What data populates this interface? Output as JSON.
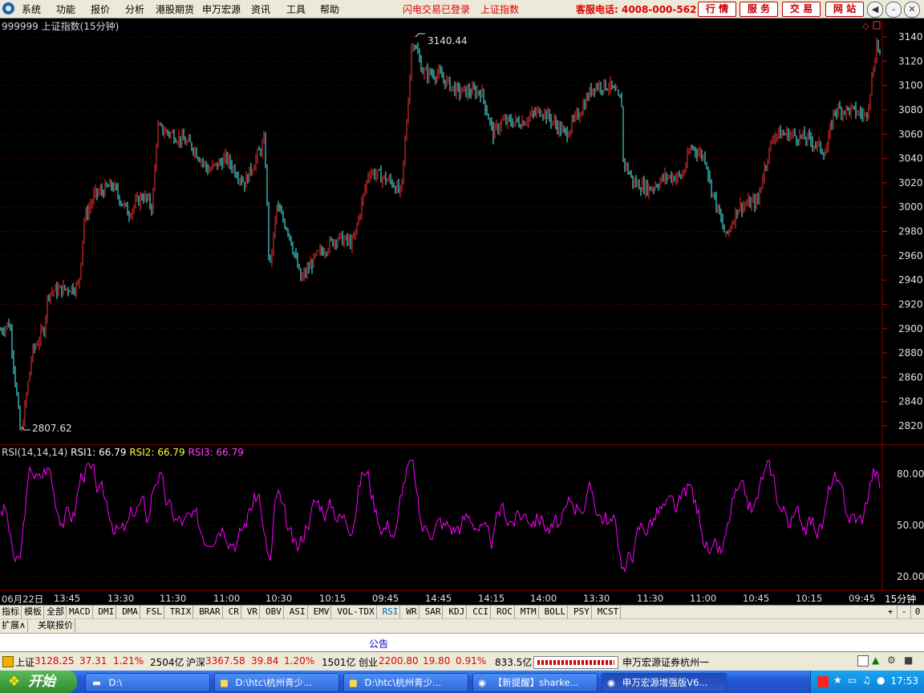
{
  "menu": {
    "items": [
      "系统",
      "功能",
      "报价",
      "分析",
      "港股期货",
      "申万宏源",
      "资讯",
      "工具",
      "帮助"
    ],
    "status_link": "闪电交易已登录",
    "index_link": "上证指数",
    "hotline": "客服电话: 4008-000-562",
    "nav_buttons": [
      "行 情",
      "服 务",
      "交 易",
      "网 站"
    ]
  },
  "chart": {
    "title": "999999 上证指数(15分钟)",
    "high_label": "3140.44",
    "low_label": "2807.62",
    "y_ticks": [
      "3140",
      "3120",
      "3100",
      "3080",
      "3060",
      "3040",
      "3020",
      "3000",
      "2980",
      "2960",
      "2940",
      "2920",
      "2900",
      "2880",
      "2860",
      "2840",
      "2820"
    ],
    "rsi_header": {
      "name": "RSI(14,14,14)",
      "rsi1_label": "RSI1:",
      "rsi1_value": "66.79",
      "rsi2_label": "RSI2:",
      "rsi2_value": "66.79",
      "rsi3_label": "RSI3:",
      "rsi3_value": "66.79"
    },
    "rsi_ticks": [
      "80.00",
      "50.00",
      "20.00"
    ],
    "time_labels": [
      "06月22日",
      "13:45",
      "13:30",
      "11:30",
      "11:00",
      "10:30",
      "10:15",
      "09:45",
      "14:45",
      "14:15",
      "14:00",
      "13:30",
      "11:30",
      "11:00",
      "10:45",
      "10:15",
      "09:45"
    ],
    "period": "15分钟",
    "colors": {
      "up": "#ff3232",
      "down": "#54ffff",
      "rsi": "#ff00ff",
      "grid": "#800000"
    }
  },
  "tabs": {
    "row1": [
      "指标",
      "模板",
      "全部",
      "MACD",
      "DMI",
      "DMA",
      "FSL",
      "TRIX",
      "BRAR",
      "CR",
      "VR",
      "OBV",
      "ASI",
      "EMV",
      "VOL-TDX",
      "RSI",
      "WR",
      "SAR",
      "KDJ",
      "CCI",
      "ROC",
      "MTM",
      "BOLL",
      "PSY",
      "MCST"
    ],
    "active": "RSI",
    "controls": [
      "+",
      "-",
      "0"
    ],
    "row2": [
      "扩展∧",
      "关联报价"
    ]
  },
  "notice": "公告",
  "status": {
    "sh_label": "上证",
    "sh_value": "3128.25",
    "sh_change": "37.31",
    "sh_pct": "1.21%",
    "sh_amount": "2504亿",
    "hs_label": "沪深",
    "hs_value": "3367.58",
    "hs_change": "39.84",
    "hs_pct": "1.20%",
    "hs_amount": "1501亿",
    "cy_label": "创业",
    "cy_value": "2200.80",
    "cy_change": "19.80",
    "cy_pct": "0.91%",
    "cy_amount": "833.5亿",
    "broker": "申万宏源证券杭州一"
  },
  "taskbar": {
    "start": "开始",
    "tasks": [
      "D:\\",
      "D:\\htc\\杭州青少...",
      "D:\\htc\\杭州青少...",
      "【新提醒】sharke...",
      "申万宏源增强版V6..."
    ],
    "clock": "17:53"
  }
}
